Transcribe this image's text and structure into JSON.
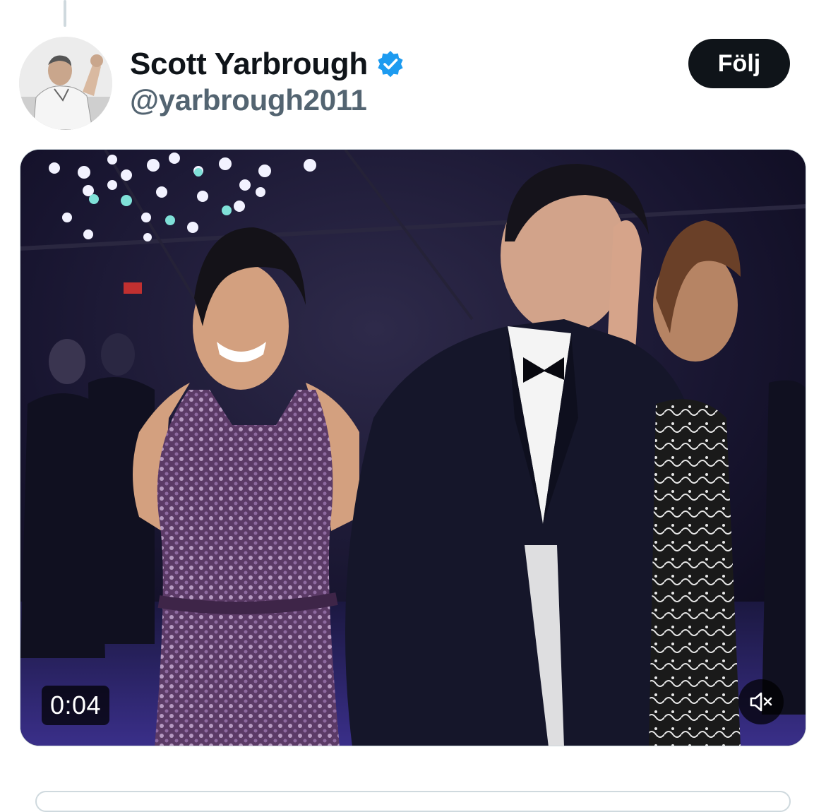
{
  "tweet": {
    "display_name": "Scott Yarbrough",
    "handle": "@yarbrough2011",
    "follow_label": "Följ",
    "verified": true,
    "colors": {
      "verified": "#1d9bf0",
      "follow_bg": "#0f1419",
      "handle": "#536471"
    }
  },
  "video": {
    "duration": "0:04",
    "muted": true,
    "icons": {
      "mute": "speaker-muted-icon"
    }
  }
}
